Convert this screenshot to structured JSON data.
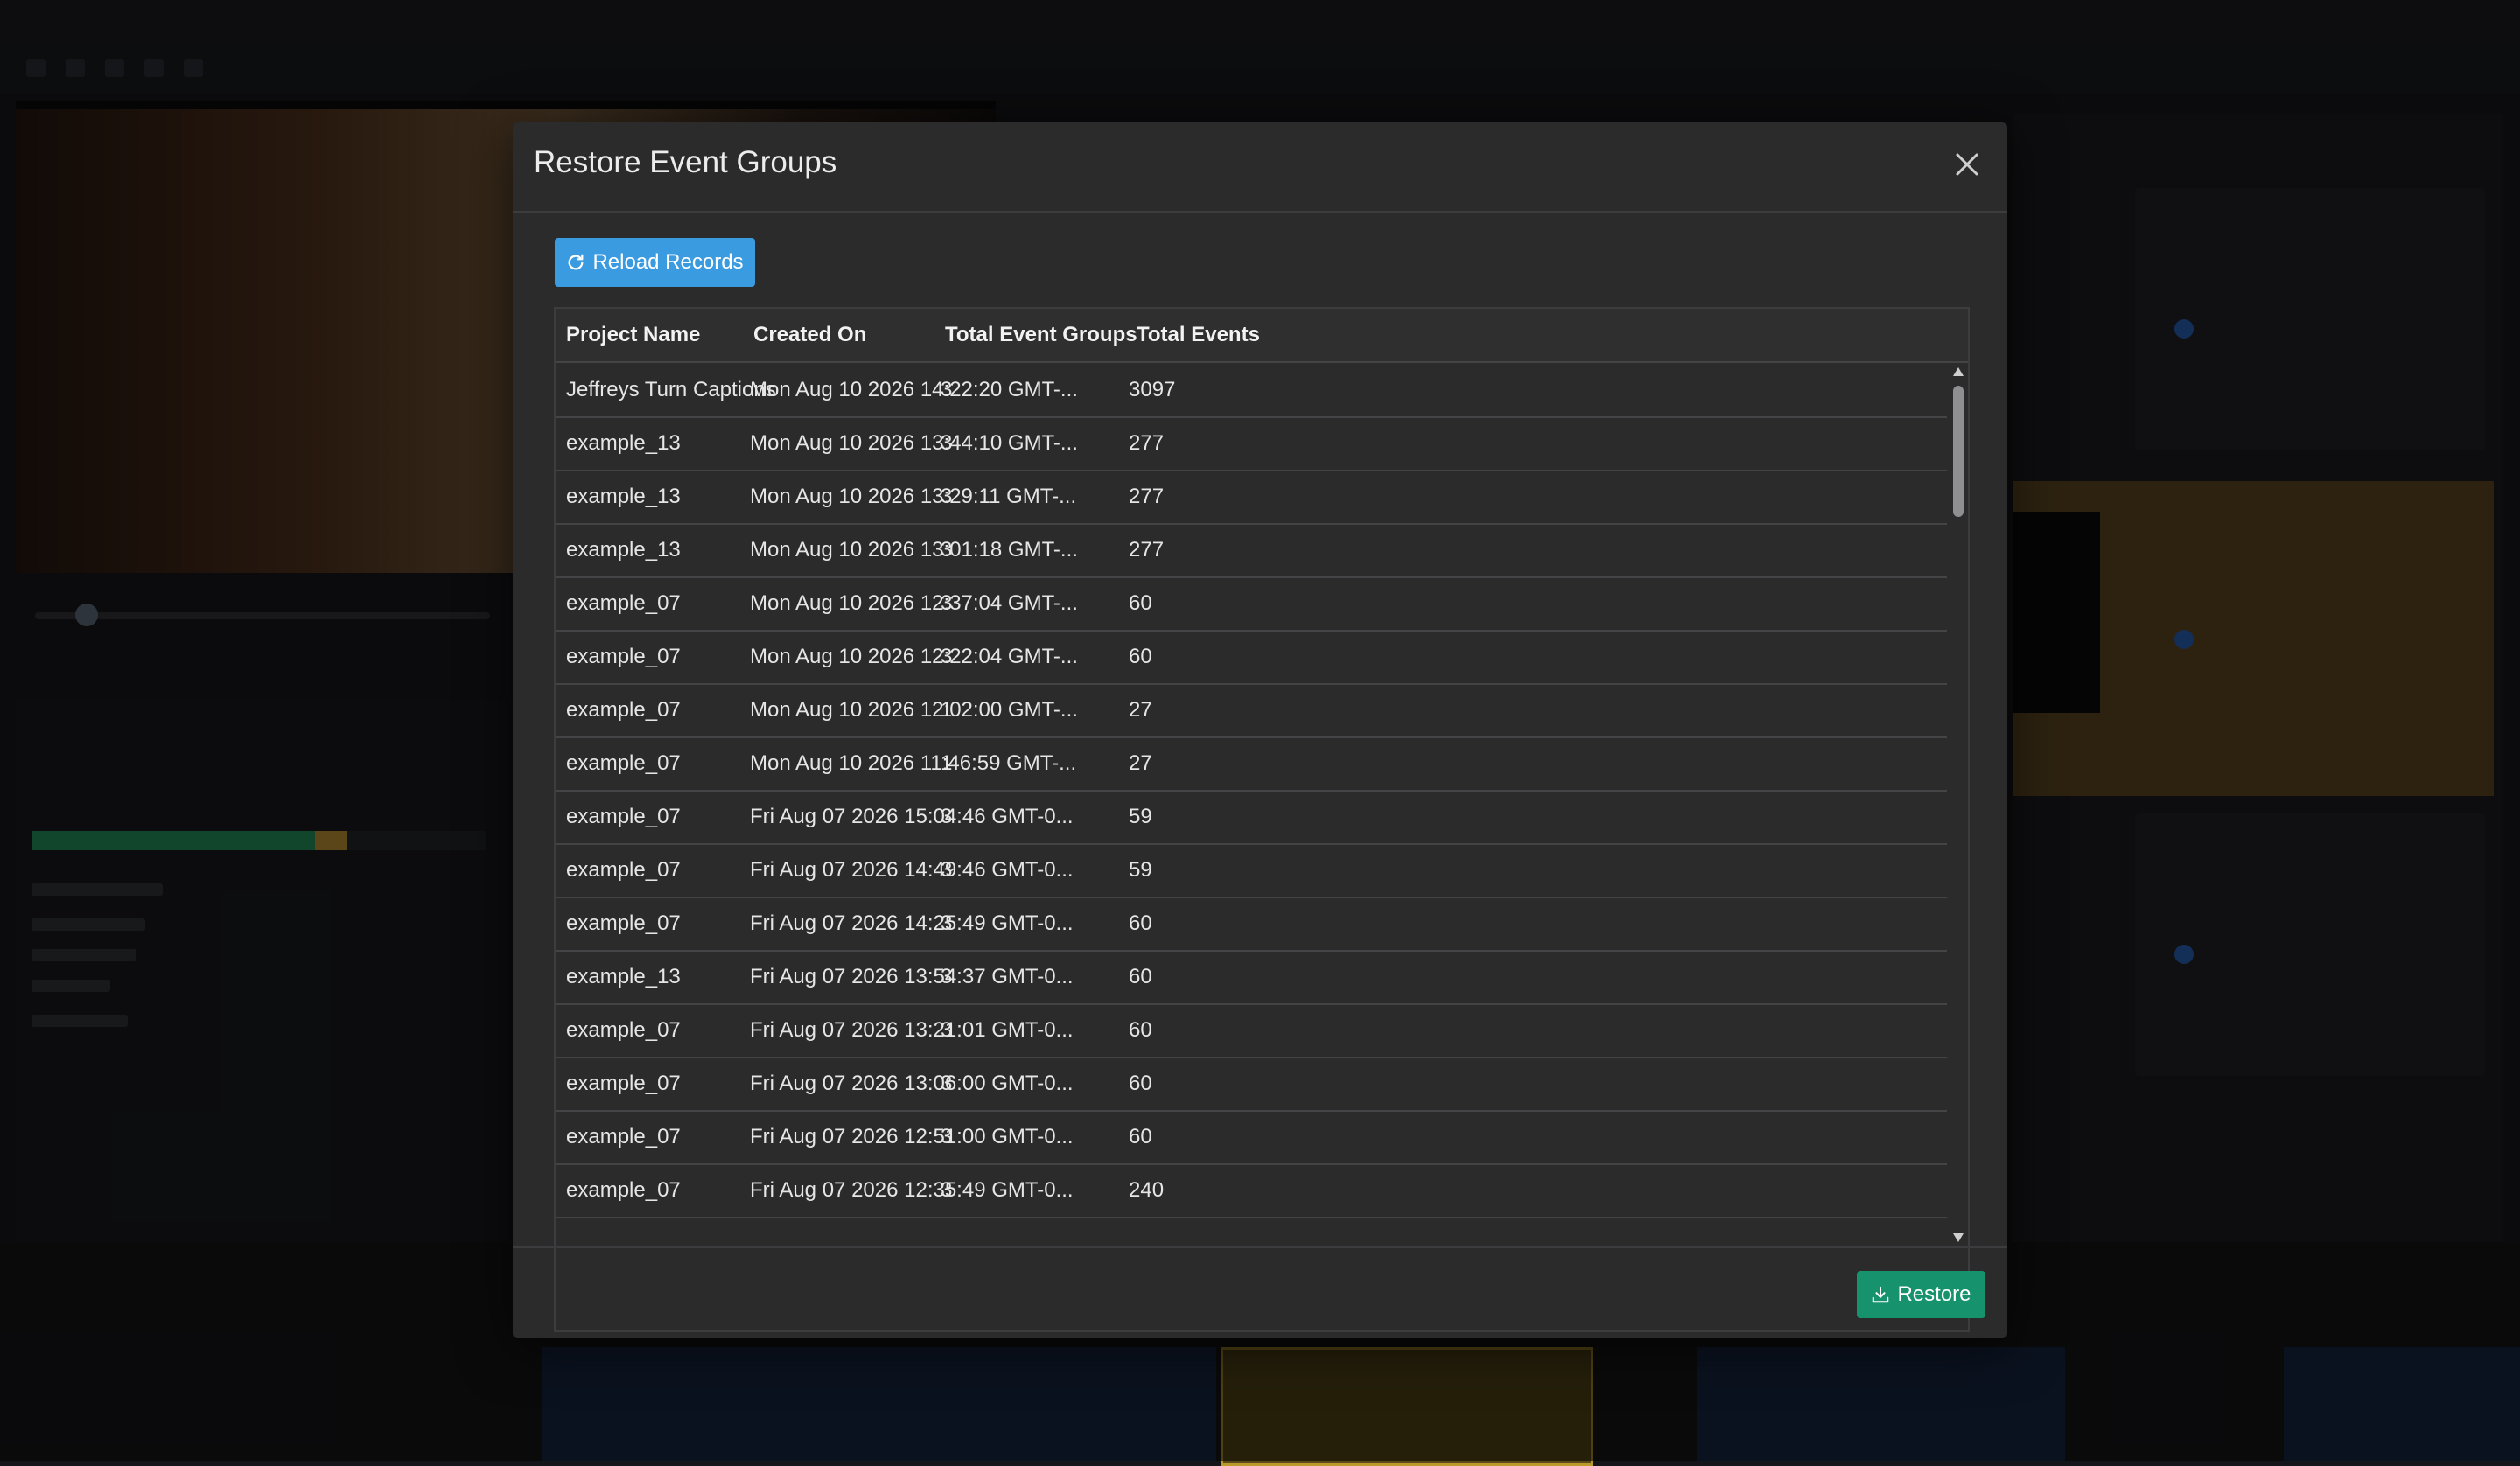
{
  "dialog": {
    "title": "Restore Event Groups",
    "reload_label": "Reload Records",
    "restore_label": "Restore"
  },
  "table": {
    "columns": [
      "Project Name",
      "Created On",
      "Total Event Groups",
      "Total Events"
    ],
    "rows": [
      {
        "project": "Jeffreys Turn Captions",
        "created": "Mon Aug 10 2026 14:22:20 GMT-...",
        "groups": "3",
        "events": "3097"
      },
      {
        "project": "example_13",
        "created": "Mon Aug 10 2026 13:44:10 GMT-...",
        "groups": "3",
        "events": "277"
      },
      {
        "project": "example_13",
        "created": "Mon Aug 10 2026 13:29:11 GMT-...",
        "groups": "3",
        "events": "277"
      },
      {
        "project": "example_13",
        "created": "Mon Aug 10 2026 13:01:18 GMT-...",
        "groups": "3",
        "events": "277"
      },
      {
        "project": "example_07",
        "created": "Mon Aug 10 2026 12:37:04 GMT-...",
        "groups": "3",
        "events": "60"
      },
      {
        "project": "example_07",
        "created": "Mon Aug 10 2026 12:22:04 GMT-...",
        "groups": "3",
        "events": "60"
      },
      {
        "project": "example_07",
        "created": "Mon Aug 10 2026 12:02:00 GMT-...",
        "groups": "1",
        "events": "27"
      },
      {
        "project": "example_07",
        "created": "Mon Aug 10 2026 11:46:59 GMT-...",
        "groups": "1",
        "events": "27"
      },
      {
        "project": "example_07",
        "created": "Fri Aug 07 2026 15:04:46 GMT-0...",
        "groups": "3",
        "events": "59"
      },
      {
        "project": "example_07",
        "created": "Fri Aug 07 2026 14:49:46 GMT-0...",
        "groups": "3",
        "events": "59"
      },
      {
        "project": "example_07",
        "created": "Fri Aug 07 2026 14:25:49 GMT-0...",
        "groups": "3",
        "events": "60"
      },
      {
        "project": "example_13",
        "created": "Fri Aug 07 2026 13:54:37 GMT-0...",
        "groups": "3",
        "events": "60"
      },
      {
        "project": "example_07",
        "created": "Fri Aug 07 2026 13:21:01 GMT-0...",
        "groups": "3",
        "events": "60"
      },
      {
        "project": "example_07",
        "created": "Fri Aug 07 2026 13:06:00 GMT-0...",
        "groups": "3",
        "events": "60"
      },
      {
        "project": "example_07",
        "created": "Fri Aug 07 2026 12:51:00 GMT-0...",
        "groups": "3",
        "events": "60"
      },
      {
        "project": "example_07",
        "created": "Fri Aug 07 2026 12:35:49 GMT-0...",
        "groups": "3",
        "events": "240"
      }
    ]
  },
  "icons": {
    "close": "close-icon",
    "reload": "refresh-icon",
    "restore": "download-icon",
    "scroll_up": "triangle-up-icon",
    "scroll_down": "triangle-down-icon"
  },
  "colors": {
    "reload_button": "#3b9be0",
    "restore_button": "#16926c",
    "dialog_bg": "#2b2b2c"
  }
}
